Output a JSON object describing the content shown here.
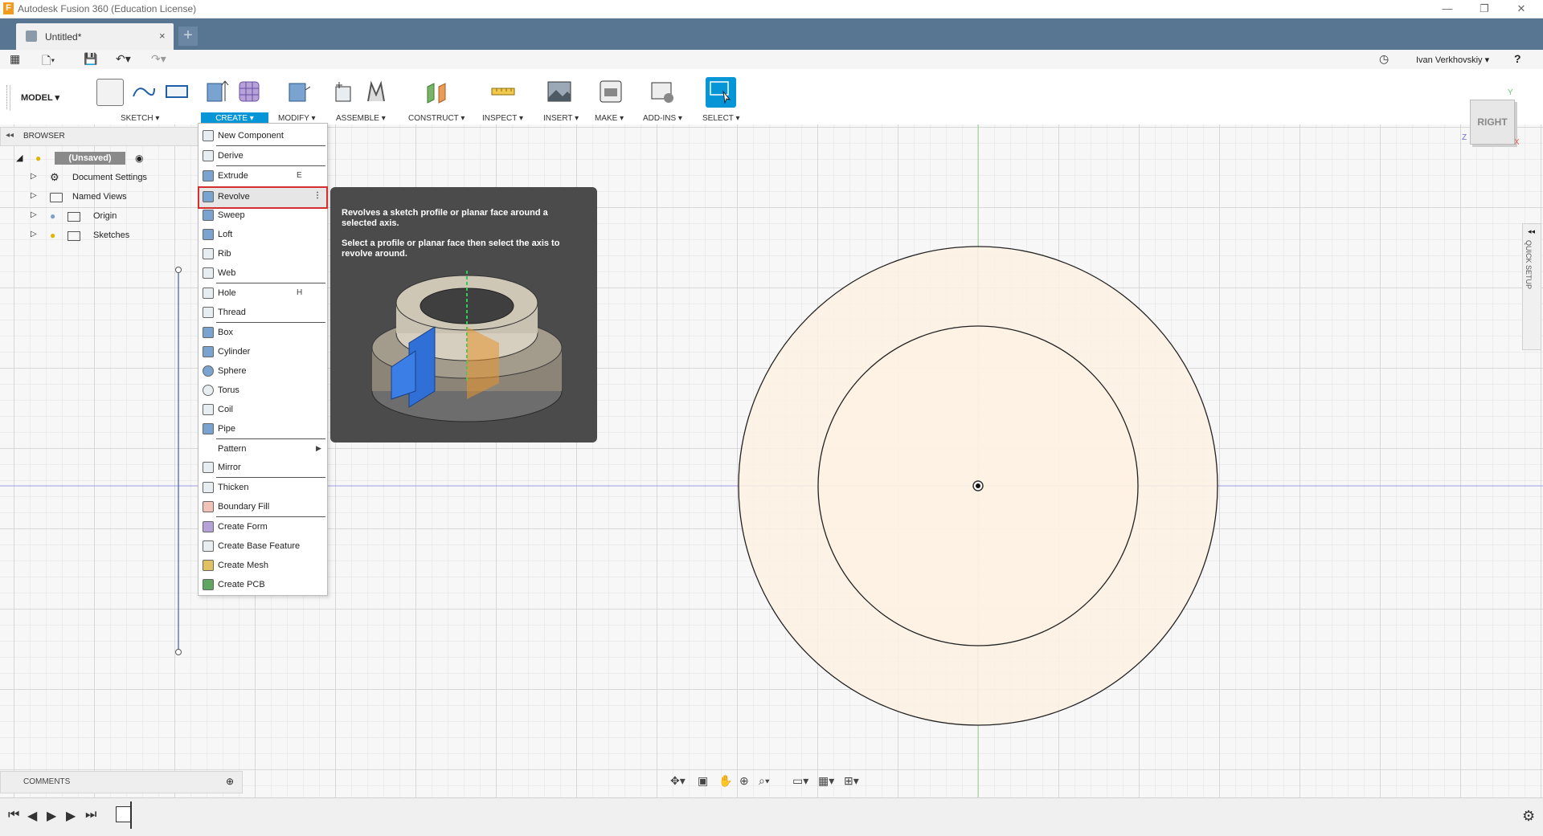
{
  "window": {
    "title": "Autodesk Fusion 360 (Education License)",
    "logo_letter": "F",
    "controls": [
      "—",
      "❐",
      "✕"
    ]
  },
  "tab": {
    "label": "Untitled*",
    "close": "×",
    "add": "+"
  },
  "user": {
    "name": "Ivan Verkhovskiy ▾",
    "help": "?"
  },
  "toolbar": {
    "workspace": "MODEL ▾",
    "groups": [
      {
        "label": "SKETCH ▾"
      },
      {
        "label": "CREATE ▾"
      },
      {
        "label": "MODIFY ▾"
      },
      {
        "label": "ASSEMBLE ▾"
      },
      {
        "label": "CONSTRUCT ▾"
      },
      {
        "label": "INSPECT ▾"
      },
      {
        "label": "INSERT ▾"
      },
      {
        "label": "MAKE ▾"
      },
      {
        "label": "ADD-INS ▾"
      },
      {
        "label": "SELECT ▾"
      }
    ]
  },
  "browser": {
    "title": "BROWSER",
    "collapse": "◂◂",
    "root": "(Unsaved)",
    "items": [
      {
        "label": "Document Settings",
        "icon": "gear-icon"
      },
      {
        "label": "Named Views",
        "icon": "folder-icon"
      },
      {
        "label": "Origin",
        "icon": "folder-icon"
      },
      {
        "label": "Sketches",
        "icon": "folder-icon"
      }
    ]
  },
  "create_menu": {
    "items": [
      {
        "label": "New Component",
        "key": ""
      },
      {
        "label": "Derive",
        "key": ""
      },
      {
        "label": "Extrude",
        "key": "E"
      },
      {
        "label": "Revolve",
        "key": "⋮"
      },
      {
        "label": "Sweep",
        "key": ""
      },
      {
        "label": "Loft",
        "key": ""
      },
      {
        "label": "Rib",
        "key": ""
      },
      {
        "label": "Web",
        "key": ""
      },
      {
        "label": "Hole",
        "key": "H"
      },
      {
        "label": "Thread",
        "key": ""
      },
      {
        "label": "Box",
        "key": ""
      },
      {
        "label": "Cylinder",
        "key": ""
      },
      {
        "label": "Sphere",
        "key": ""
      },
      {
        "label": "Torus",
        "key": ""
      },
      {
        "label": "Coil",
        "key": ""
      },
      {
        "label": "Pipe",
        "key": ""
      },
      {
        "label": "Pattern",
        "key": "▶"
      },
      {
        "label": "Mirror",
        "key": ""
      },
      {
        "label": "Thicken",
        "key": ""
      },
      {
        "label": "Boundary Fill",
        "key": ""
      },
      {
        "label": "Create Form",
        "key": ""
      },
      {
        "label": "Create Base Feature",
        "key": ""
      },
      {
        "label": "Create Mesh",
        "key": ""
      },
      {
        "label": "Create PCB",
        "key": ""
      }
    ],
    "highlighted": "Revolve"
  },
  "tooltip": {
    "line1": "Revolves a sketch profile or planar face around a selected axis.",
    "line2": "Select a profile or planar face then select the axis to revolve around."
  },
  "comments": {
    "label": "COMMENTS"
  },
  "viewcube": {
    "face": "RIGHT",
    "axis_y": "Y",
    "axis_z": "Z",
    "axis_x": "X"
  },
  "quick_setup": "QUICK SETUP",
  "colors": {
    "accent": "#0696d7",
    "tab_bar": "#587592",
    "tooltip": "#4b4b4b",
    "profile_fill": "#fdf1e2",
    "highlight": "#d32f2f"
  }
}
